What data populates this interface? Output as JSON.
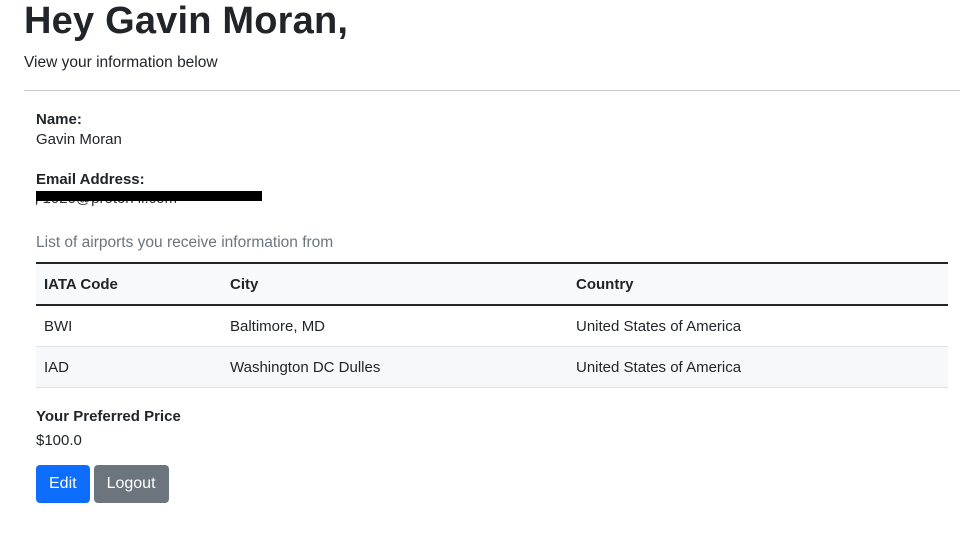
{
  "header": {
    "greeting": "Hey Gavin Moran,",
    "subtitle": "View your information below"
  },
  "profile": {
    "name_label": "Name:",
    "name_value": "Gavin Moran",
    "email_label": "Email Address:",
    "email_value_visible_fragment": "g      1020@proton   il.com"
  },
  "airports": {
    "caption": "List of airports you receive information from",
    "columns": [
      "IATA Code",
      "City",
      "Country"
    ],
    "rows": [
      [
        "BWI",
        "Baltimore, MD",
        "United States of America"
      ],
      [
        "IAD",
        "Washington DC Dulles",
        "United States of America"
      ]
    ]
  },
  "price": {
    "label": "Your Preferred Price",
    "value": "$100.0"
  },
  "actions": {
    "edit_label": "Edit",
    "logout_label": "Logout"
  },
  "colors": {
    "primary": "#0d6efd",
    "secondary": "#6c757d",
    "muted_text": "#6c757d"
  }
}
